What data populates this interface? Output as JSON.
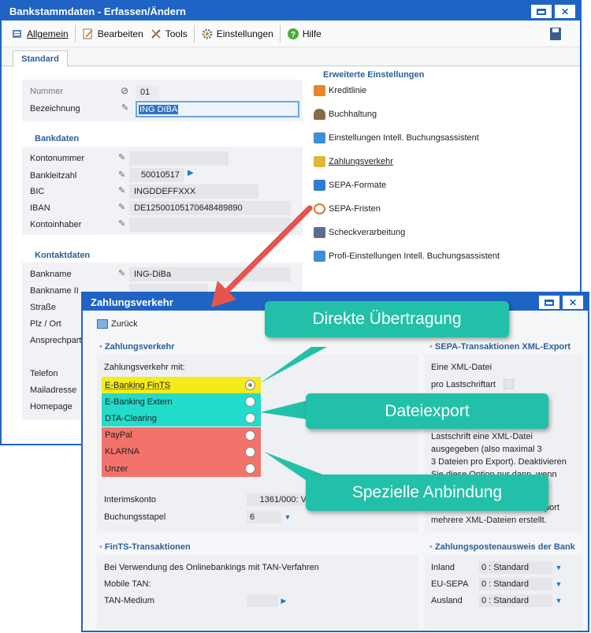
{
  "window1": {
    "title": "Bankstammdaten - Erfassen/Ändern",
    "toolbar": {
      "allgemein": "Allgemein",
      "bearbeiten": "Bearbeiten",
      "tools": "Tools",
      "einstellungen": "Einstellungen",
      "hilfe": "Hilfe"
    },
    "tab": "Standard",
    "general": {
      "nummer_label": "Nummer",
      "nummer_value": "01",
      "bezeichnung_label": "Bezeichnung",
      "bezeichnung_value": "ING DIBA"
    },
    "bankdaten": {
      "title": "Bankdaten",
      "kontonummer_label": "Kontonummer",
      "kontonummer_value": "",
      "bankleitzahl_label": "Bankleitzahl",
      "bankleitzahl_value": "50010517",
      "bic_label": "BIC",
      "bic_value": "INGDDEFFXXX",
      "iban_label": "IBAN",
      "iban_value": "DE12500105170648489890",
      "kontoinhaber_label": "Kontoinhaber",
      "kontoinhaber_value": ""
    },
    "kontaktdaten": {
      "title": "Kontaktdaten",
      "bankname_label": "Bankname",
      "bankname_value": "ING-DiBa",
      "bankname2_label": "Bankname II",
      "strasse_label": "Straße",
      "plz_label": "Plz / Ort",
      "ansprechpartner_label": "Ansprechpart",
      "telefon_label": "Telefon",
      "mailadresse_label": "Mailadresse",
      "homepage_label": "Homepage"
    },
    "erweitert": {
      "title": "Erweiterte Einstellungen",
      "items": [
        "Kreditlinie",
        "Buchhaltung",
        "Einstellungen Intell. Buchungsassistent",
        "Zahlungsverkehr",
        "SEPA-Formate",
        "SEPA-Fristen",
        "Scheckverarbeitung",
        "Profi-Einstellungen Intell. Buchungsassistent"
      ]
    }
  },
  "window2": {
    "title": "Zahlungsverkehr",
    "back": "Zurück",
    "zv_section": "Zahlungsverkehr",
    "zv_mit": "Zahlungsverkehr mit:",
    "options": [
      {
        "label": "E-Banking FinTS",
        "color": "#f5ea1a",
        "selected": true
      },
      {
        "label": "E-Banking Extern",
        "color": "#22dccb",
        "selected": false
      },
      {
        "label": "DTA-Clearing",
        "color": "#22dccb",
        "selected": false
      },
      {
        "label": "PayPal",
        "color": "#f2736b",
        "selected": false
      },
      {
        "label": "KLARNA",
        "color": "#f2736b",
        "selected": false
      },
      {
        "label": "Unzer",
        "color": "#f2736b",
        "selected": false
      }
    ],
    "interimskonto_label": "Interimskonto",
    "interimskonto_value": "1361/000: V",
    "buchungsstapel_label": "Buchungsstapel",
    "buchungsstapel_value": "6",
    "fints_section": "FinTS-Transaktionen",
    "fints_text": "Bei Verwendung des Onlinebankings mit TAN-Verfahren",
    "mobile_tan_label": "Mobile TAN:",
    "tan_medium_label": "TAN-Medium",
    "sepa_section": "SEPA-Transaktionen XML-Export",
    "sepa_line1": "Eine XML-Datei",
    "sepa_line2": "pro Lastschriftart",
    "sepa_desc": [
      "Lastschrift eine XML-Datei",
      "ausgegeben (also maximal 3",
      "3 Dateien pro Export). Deaktivieren",
      "Sie diese Option nur dann, wenn"
    ],
    "sepa_desc_tail": [
      "port",
      "mehrere XML-Dateien erstellt."
    ],
    "zpa_section": "Zahlungspostenausweis der Bank",
    "zpa_rows": [
      {
        "label": "Inland",
        "value": "0 : Standard"
      },
      {
        "label": "EU-SEPA",
        "value": "0 : Standard"
      },
      {
        "label": "Ausland",
        "value": "0 : Standard"
      }
    ]
  },
  "callouts": {
    "direkt": "Direkte Übertragung",
    "datei": "Dateiexport",
    "speziell": "Spezielle Anbindung"
  },
  "colors": {
    "titlebar": "#1f64c4",
    "section_title": "#2c5f96",
    "callout": "#22c0a8",
    "arrow": "#e8534d"
  }
}
